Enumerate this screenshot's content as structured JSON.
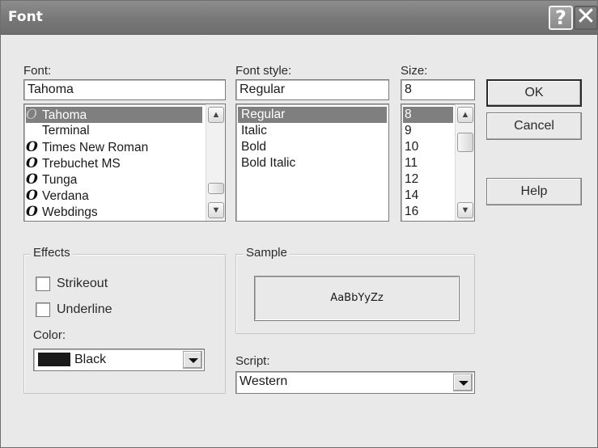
{
  "window": {
    "title": "Font",
    "help_glyph": "?",
    "close_glyph": "✕"
  },
  "font": {
    "label": "Font:",
    "value": "Tahoma",
    "items": [
      {
        "name": "Tahoma",
        "icon": "O",
        "selected": true
      },
      {
        "name": "Terminal",
        "icon": "",
        "selected": false
      },
      {
        "name": "Times New Roman",
        "icon": "O",
        "selected": false
      },
      {
        "name": "Trebuchet MS",
        "icon": "O",
        "selected": false
      },
      {
        "name": "Tunga",
        "icon": "O",
        "selected": false
      },
      {
        "name": "Verdana",
        "icon": "O",
        "selected": false
      },
      {
        "name": "Webdings",
        "icon": "O",
        "selected": false
      }
    ]
  },
  "style": {
    "label": "Font style:",
    "value": "Regular",
    "items": [
      "Regular",
      "Italic",
      "Bold",
      "Bold Italic"
    ]
  },
  "size": {
    "label": "Size:",
    "value": "8",
    "items": [
      "8",
      "9",
      "10",
      "11",
      "12",
      "14",
      "16"
    ]
  },
  "buttons": {
    "ok": "OK",
    "cancel": "Cancel",
    "help": "Help"
  },
  "effects": {
    "label": "Effects",
    "strikeout": "Strikeout",
    "underline": "Underline",
    "color_label": "Color:",
    "color_value": "Black",
    "color_hex": "#1a1a1a"
  },
  "sample": {
    "label": "Sample",
    "text": "AaBbYyZz"
  },
  "script": {
    "label": "Script:",
    "value": "Western"
  }
}
